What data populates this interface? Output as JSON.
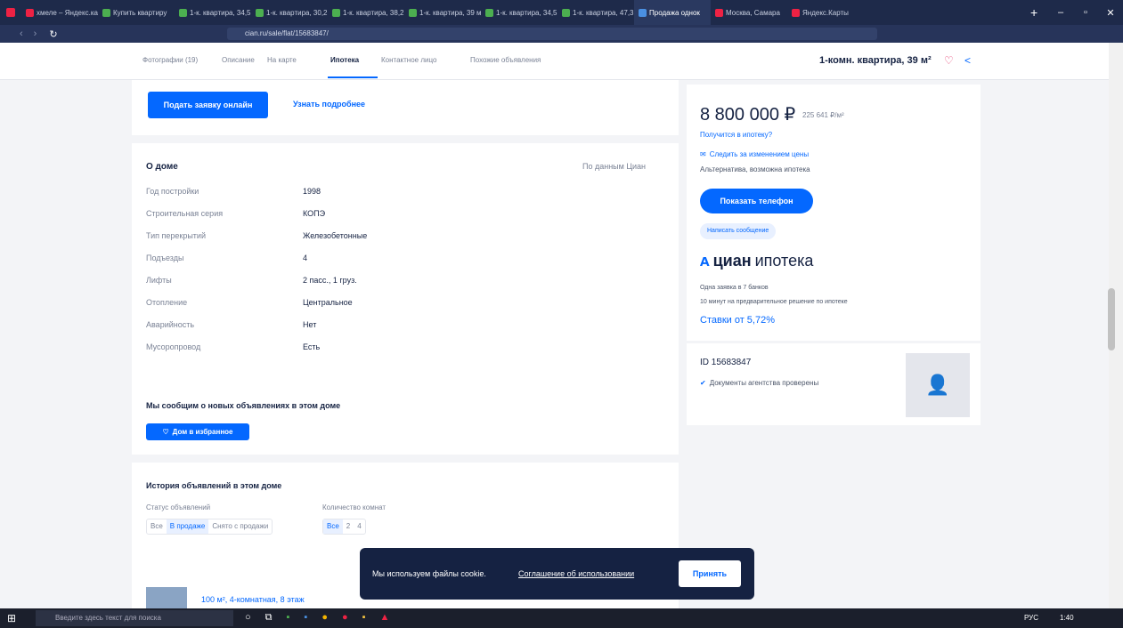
{
  "browser": {
    "tabs": [
      "хмеле – Яндекс.ка",
      "Купить квартиру",
      "1-к. квартира, 34,5 м",
      "1-к. квартира, 30,2 м",
      "1-к. квартира, 38,2 м",
      "1-к. квартира, 39 м",
      "1-к. квартира, 34,5 м",
      "1-к. квартира, 47,3 м",
      "Продажа однок",
      "Москва, Самара",
      "Яндекс.Карты"
    ],
    "url": "cian.ru/sale/flat/15683847/"
  },
  "nav": {
    "links": [
      "Фотографии (19)",
      "Описание",
      "На карте",
      "Ипотека",
      "Контактное лицо",
      "Похожие объявления"
    ],
    "title": "1-комн. квартира, 39 м²"
  },
  "mortgage": {
    "apply": "Подать заявку онлайн",
    "more": "Узнать подробнее"
  },
  "house": {
    "title": "О доме",
    "source": "По данным Циан",
    "rows": [
      {
        "k": "Год постройки",
        "v": "1998"
      },
      {
        "k": "Строительная серия",
        "v": "КОПЭ"
      },
      {
        "k": "Тип перекрытий",
        "v": "Железобетонные"
      },
      {
        "k": "Подъезды",
        "v": "4"
      },
      {
        "k": "Лифты",
        "v": "2 пасс., 1 груз."
      },
      {
        "k": "Отопление",
        "v": "Центральное"
      },
      {
        "k": "Аварийность",
        "v": "Нет"
      },
      {
        "k": "Мусоропровод",
        "v": "Есть"
      }
    ],
    "notify": "Мы сообщим о новых объявлениях в этом доме",
    "fav": "Дом в избранное"
  },
  "history": {
    "title": "История объявлений в этом доме",
    "status_label": "Статус объявлений",
    "status": [
      "Все",
      "В продаже",
      "Снято с продажи"
    ],
    "rooms_label": "Количество комнат",
    "rooms": [
      "Все",
      "2",
      "4"
    ],
    "row_title": "100 м², 4-комнатная, 8 этаж"
  },
  "price": {
    "value": "8 800 000 ₽",
    "per": "225 641 ₽/м²",
    "mortgage_q": "Получится в ипотеку?",
    "watch": "Следить за изменением цены",
    "note": "Альтернатива, возможна ипотека",
    "phone": "Показать телефон",
    "message": "Написать сообщение"
  },
  "cianipoteka": {
    "logo_a": "циан",
    "logo_b": "ипотека",
    "l1": "Одна заявка в 7 банков",
    "l2": "10 минут на предварительное решение по ипотеке",
    "rate": "Ставки от 5,72%"
  },
  "agent": {
    "id": "ID 15683847",
    "verified": "Документы агентства проверены"
  },
  "cookie": {
    "text": "Мы используем файлы cookie.",
    "link": "Соглашение об использовании",
    "accept": "Принять"
  },
  "taskbar": {
    "search": "Введите здесь текст для поиска",
    "time": "1:40",
    "lang": "РУС"
  },
  "colors": {
    "accent": "#0468ff",
    "text": "#152242"
  }
}
